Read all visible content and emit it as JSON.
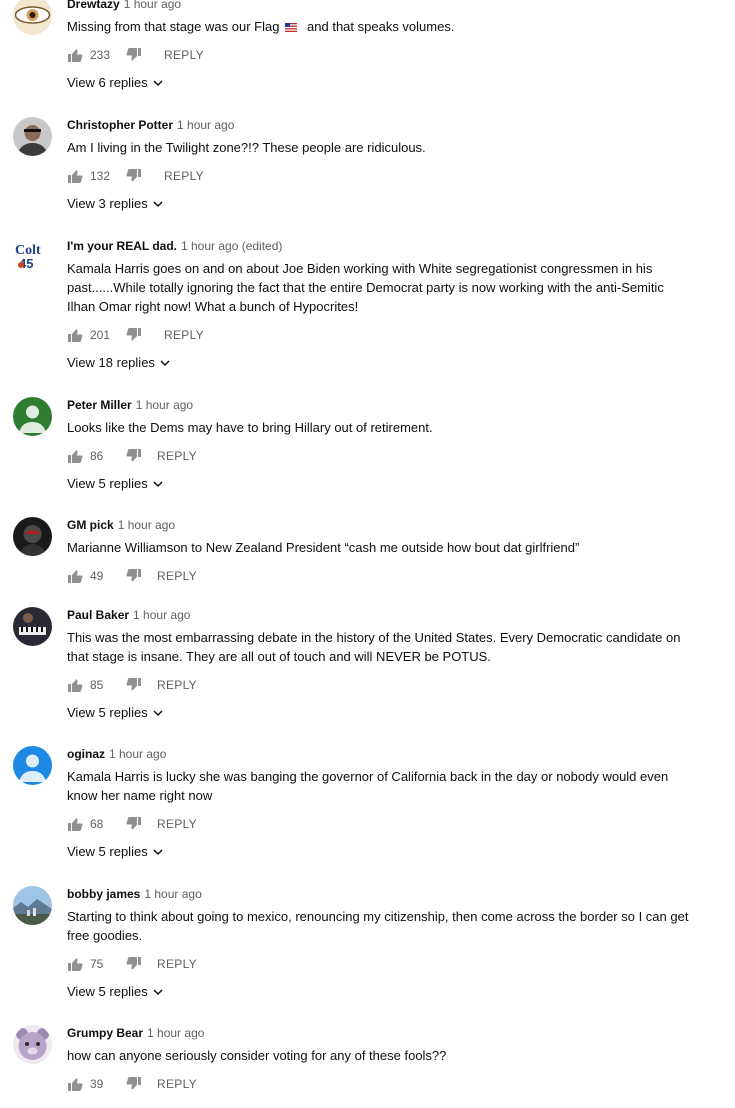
{
  "comments": [
    {
      "author": "Drewtazy",
      "meta": "1 hour ago",
      "text_a": "Missing from that stage was our Flag",
      "text_b": " and that speaks volumes.",
      "likes": "233",
      "reply": "REPLY",
      "replies": "View 6 replies",
      "avatar_color": "#d9a25a"
    },
    {
      "author": "Christopher Potter",
      "meta": "1 hour ago",
      "text": "Am I living in the Twilight zone?!? These people are ridiculous.",
      "likes": "132",
      "reply": "REPLY",
      "replies": "View 3 replies",
      "avatar_color": "#3b3b3b"
    },
    {
      "author": "I'm your REAL dad.",
      "meta": "1 hour ago (edited)",
      "text": "Kamala Harris goes on and on about Joe Biden working with White segregationist congressmen in his past......While totally ignoring the fact that the entire Democrat party is now working with the anti-Semitic Ilhan Omar right now! What a bunch of Hypocrites!",
      "likes": "201",
      "reply": "REPLY",
      "replies": "View 18 replies",
      "avatar_color": "#1f3f8a"
    },
    {
      "author": "Peter Miller",
      "meta": "1 hour ago",
      "text": "Looks like the Dems may have to bring Hillary out of retirement.",
      "likes": "86",
      "reply": "REPLY",
      "replies": "View 5 replies",
      "avatar_color": "#2e7d32"
    },
    {
      "author": "GM pick",
      "meta": "1 hour ago",
      "text": "Marianne Williamson to New Zealand President “cash me outside how bout dat girlfriend”",
      "likes": "49",
      "reply": "REPLY",
      "replies": "",
      "avatar_color": "#1a1a1a"
    },
    {
      "author": "Paul Baker",
      "meta": "1 hour ago",
      "text": "This was the most embarrassing debate in the history of the United States. Every Democratic candidate on that stage is insane. They are all out of touch and will NEVER be POTUS.",
      "likes": "85",
      "reply": "REPLY",
      "replies": "View 5 replies",
      "avatar_color": "#2a2a35"
    },
    {
      "author": "oginaz",
      "meta": "1 hour ago",
      "text": "Kamala Harris is lucky she was banging the governor of California back in the day or nobody would even know her name right now",
      "likes": "68",
      "reply": "REPLY",
      "replies": "View 5 replies",
      "avatar_color": "#1e88e5"
    },
    {
      "author": "bobby james",
      "meta": "1 hour ago",
      "text": "Starting to think about going to mexico, renouncing my citizenship, then come across the border so I can get free goodies.",
      "likes": "75",
      "reply": "REPLY",
      "replies": "View 5 replies",
      "avatar_color": "#6d8fb0"
    },
    {
      "author": "Grumpy Bear",
      "meta": "1 hour ago",
      "text": "how can anyone seriously consider voting for any of these fools??",
      "likes": "39",
      "reply": "REPLY",
      "replies": "",
      "avatar_color": "#b9a4c9"
    }
  ]
}
